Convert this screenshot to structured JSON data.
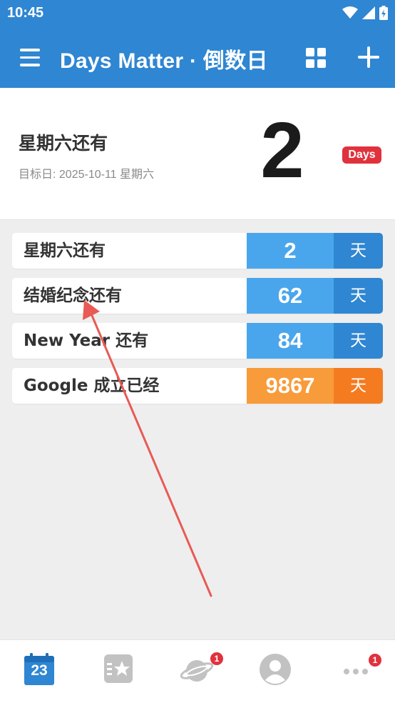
{
  "status_bar": {
    "time": "10:45"
  },
  "toolbar": {
    "title": "Days Matter · 倒数日"
  },
  "hero": {
    "title": "星期六还有",
    "subtitle": "目标日: 2025-10-11 星期六",
    "number": "2",
    "badge": "Days"
  },
  "events": [
    {
      "title": "星期六还有",
      "number": "2",
      "unit": "天",
      "color": "#4aa6ec",
      "unit_color": "#2f86d2"
    },
    {
      "title": "结婚纪念还有",
      "number": "62",
      "unit": "天",
      "color": "#4aa6ec",
      "unit_color": "#2f86d2"
    },
    {
      "title": "New Year 还有",
      "number": "84",
      "unit": "天",
      "color": "#4aa6ec",
      "unit_color": "#2f86d2"
    },
    {
      "title": "Google 成立已经",
      "number": "9867",
      "unit": "天",
      "color": "#f89b3a",
      "unit_color": "#f47b1f"
    }
  ],
  "bottom_nav": {
    "calendar_day": "23",
    "discover_badge": "1",
    "more_badge": "1"
  },
  "colors": {
    "primary": "#2f86d2",
    "accent_red": "#e0323d"
  }
}
